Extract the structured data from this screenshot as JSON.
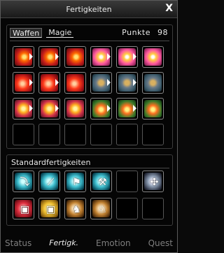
{
  "window": {
    "title": "Fertigkeiten",
    "close_label": "X"
  },
  "skills_tabs": [
    {
      "label": "Waffen",
      "active": true
    },
    {
      "label": "Magie",
      "active": false
    }
  ],
  "points": {
    "label": "Punkte",
    "value": "98"
  },
  "skill_slots": [
    {
      "icon": "fire-slash-icon",
      "style": "fire",
      "arrow": true
    },
    {
      "icon": "fire-slash-icon",
      "style": "fire",
      "arrow": true
    },
    {
      "icon": "fire-slash-icon",
      "style": "fire",
      "arrow": false
    },
    {
      "icon": "spark-burst-icon",
      "style": "burst",
      "arrow": true
    },
    {
      "icon": "spark-burst-icon",
      "style": "burst",
      "arrow": true
    },
    {
      "icon": "spark-burst-icon",
      "style": "burst",
      "arrow": false
    },
    {
      "icon": "flame-figure-icon",
      "style": "fire2",
      "arrow": true
    },
    {
      "icon": "flame-figure-icon",
      "style": "fire2",
      "arrow": true
    },
    {
      "icon": "flame-figure-icon",
      "style": "fire2",
      "arrow": false
    },
    {
      "icon": "shield-gear-icon",
      "style": "shield",
      "arrow": true
    },
    {
      "icon": "shield-gear-icon",
      "style": "shield",
      "arrow": true
    },
    {
      "icon": "shield-gear-icon",
      "style": "shield",
      "arrow": false
    },
    {
      "icon": "magic-strike-icon",
      "style": "magic",
      "arrow": true
    },
    {
      "icon": "magic-strike-icon",
      "style": "magic",
      "arrow": true
    },
    {
      "icon": "magic-strike-icon",
      "style": "magic",
      "arrow": false
    },
    {
      "icon": "nature-blast-icon",
      "style": "green",
      "arrow": true
    },
    {
      "icon": "nature-blast-icon",
      "style": "green",
      "arrow": true
    },
    {
      "icon": "nature-blast-icon",
      "style": "green",
      "arrow": false
    },
    {
      "icon": "",
      "style": "",
      "arrow": false
    },
    {
      "icon": "",
      "style": "",
      "arrow": false
    },
    {
      "icon": "",
      "style": "",
      "arrow": false
    },
    {
      "icon": "",
      "style": "",
      "arrow": false
    },
    {
      "icon": "",
      "style": "",
      "arrow": false
    },
    {
      "icon": "",
      "style": "",
      "arrow": false
    }
  ],
  "standard": {
    "title": "Standardfertigkeiten",
    "slots": [
      {
        "icon": "fishing-icon",
        "style": "cyan",
        "glyph": "⤵"
      },
      {
        "icon": "rod-icon",
        "style": "cyan",
        "glyph": "⟋"
      },
      {
        "icon": "flag-icon",
        "style": "cyan",
        "glyph": "⚑"
      },
      {
        "icon": "pickaxe-icon",
        "style": "cyan",
        "glyph": "⚒"
      },
      {
        "icon": "",
        "style": "",
        "glyph": ""
      },
      {
        "icon": "knot-icon",
        "style": "knot",
        "glyph": "✣"
      },
      {
        "icon": "red-scroll-icon",
        "style": "red2",
        "glyph": "▣"
      },
      {
        "icon": "gold-scroll-icon",
        "style": "gold",
        "glyph": "▣"
      },
      {
        "icon": "horse-icon",
        "style": "horse",
        "glyph": "♞"
      },
      {
        "icon": "horse-riding-icon",
        "style": "horse",
        "glyph": "♘"
      },
      {
        "icon": "",
        "style": "",
        "glyph": ""
      },
      {
        "icon": "",
        "style": "",
        "glyph": ""
      }
    ]
  },
  "bottom_tabs": [
    {
      "label": "Status",
      "active": false
    },
    {
      "label": "Fertigk.",
      "active": true
    },
    {
      "label": "Emotion",
      "active": false
    },
    {
      "label": "Quest",
      "active": false
    }
  ]
}
